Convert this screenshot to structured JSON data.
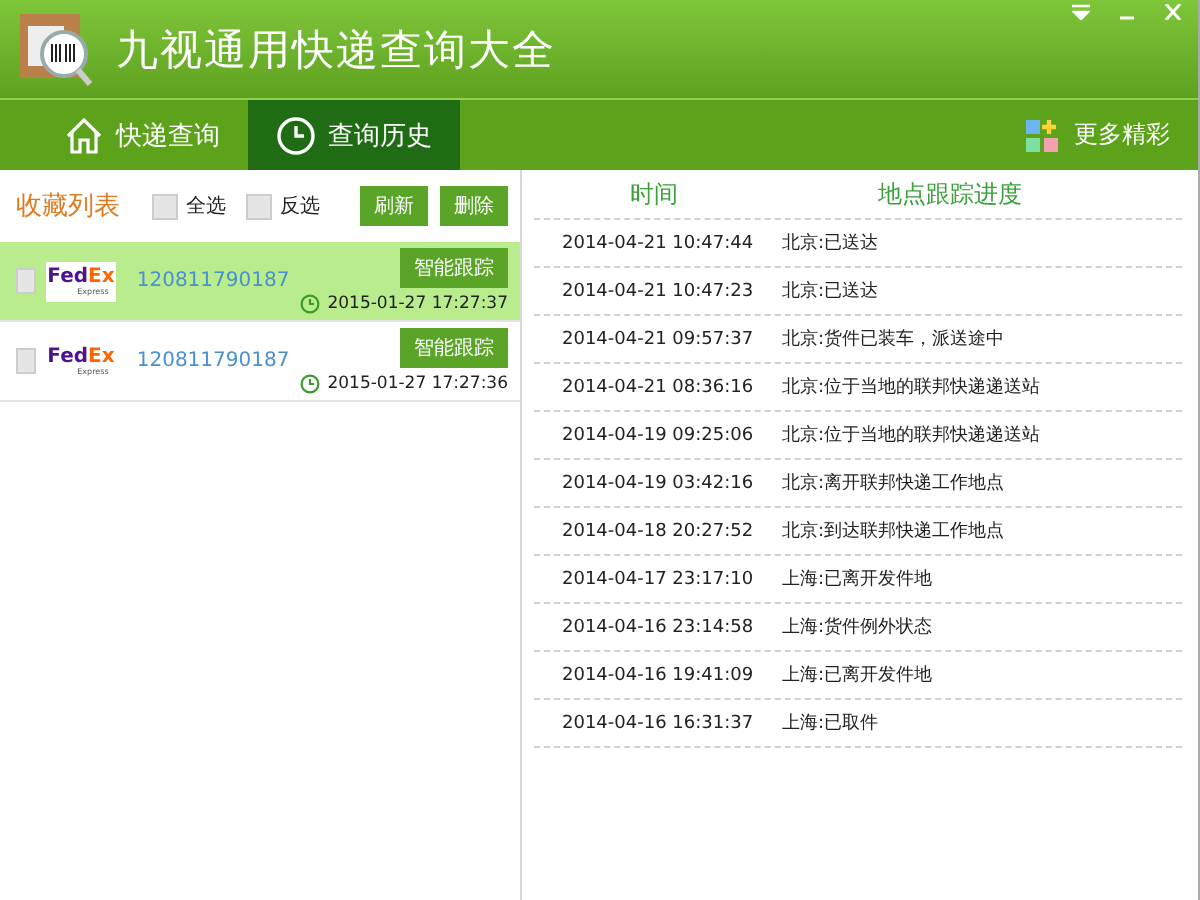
{
  "window": {
    "title": "九视通用快递查询大全"
  },
  "nav": {
    "tabs": [
      {
        "label": "快递查询",
        "kind": "home",
        "selected": false
      },
      {
        "label": "查询历史",
        "kind": "clock",
        "selected": true
      }
    ],
    "more": "更多精彩"
  },
  "favorites": {
    "title": "收藏列表",
    "options": [
      {
        "label": "全选",
        "checked": false
      },
      {
        "label": "反选",
        "checked": false
      }
    ],
    "buttons": [
      "刷新",
      "删除"
    ],
    "items": [
      {
        "logo": "FedEx",
        "logo_tagline": "Express",
        "number": "120811790187",
        "action": "智能跟踪",
        "time": "2015-01-27 17:27:37",
        "selected": true,
        "checked": false
      },
      {
        "logo": "FedEx",
        "logo_tagline": "Express",
        "number": "120811790187",
        "action": "智能跟踪",
        "time": "2015-01-27 17:27:36",
        "selected": false,
        "checked": false
      }
    ]
  },
  "tracking": {
    "columns": [
      "时间",
      "地点跟踪进度"
    ],
    "rows": [
      {
        "time": "2014-04-21 10:47:44",
        "status": "北京:已送达"
      },
      {
        "time": "2014-04-21 10:47:23",
        "status": "北京:已送达"
      },
      {
        "time": "2014-04-21 09:57:37",
        "status": "北京:货件已装车，派送途中"
      },
      {
        "time": "2014-04-21 08:36:16",
        "status": "北京:位于当地的联邦快递递送站"
      },
      {
        "time": "2014-04-19 09:25:06",
        "status": "北京:位于当地的联邦快递递送站"
      },
      {
        "time": "2014-04-19 03:42:16",
        "status": "北京:离开联邦快递工作地点"
      },
      {
        "time": "2014-04-18 20:27:52",
        "status": "北京:到达联邦快递工作地点"
      },
      {
        "time": "2014-04-17 23:17:10",
        "status": "上海:已离开发件地"
      },
      {
        "time": "2014-04-16 23:14:58",
        "status": "上海:货件例外状态"
      },
      {
        "time": "2014-04-16 19:41:09",
        "status": "上海:已离开发件地"
      },
      {
        "time": "2014-04-16 16:31:37",
        "status": "上海:已取件"
      }
    ]
  }
}
